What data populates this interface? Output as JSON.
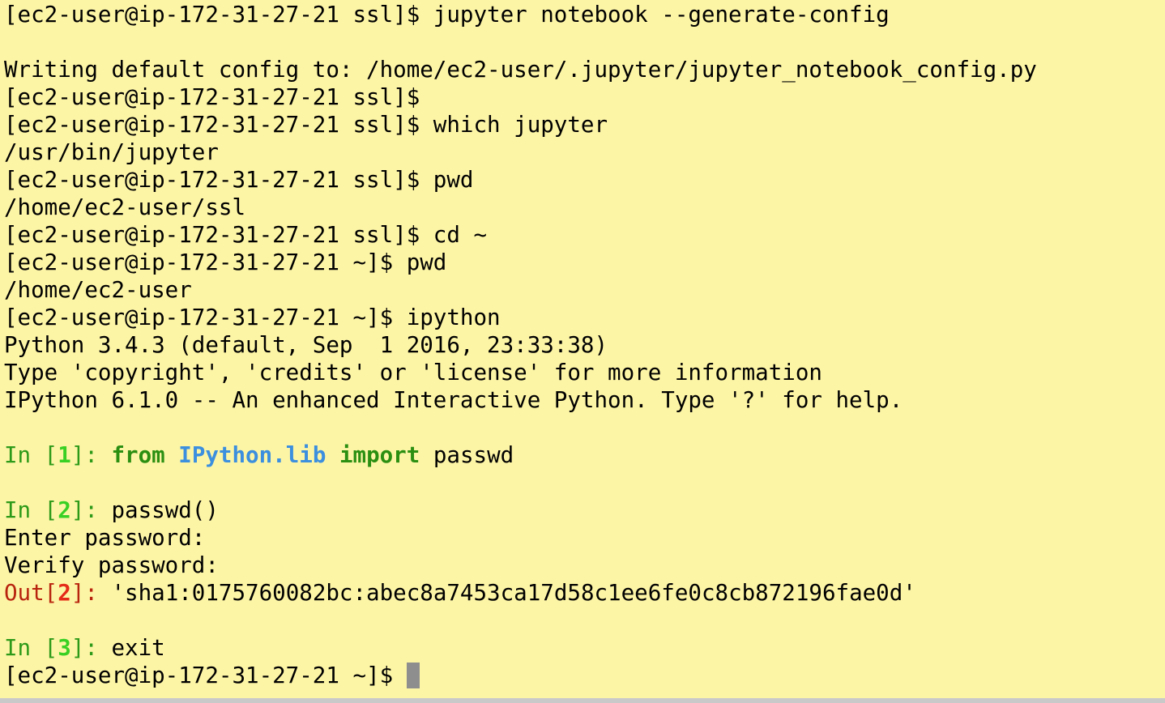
{
  "terminal": {
    "colors": {
      "background": "#fdf5a6",
      "text": "#000000",
      "prompt_green": "#2e9a19",
      "number_green": "#39d024",
      "keyword_green": "#2b8f12",
      "module_blue": "#3b8fde",
      "out_red": "#b8250f",
      "out_number_red": "#e42a18",
      "cursor": "#8e8e8e"
    },
    "lines": [
      {
        "segments": [
          {
            "text": "[ec2-user@ip-172-31-27-21 ssl]$ jupyter notebook --generate-config"
          }
        ]
      },
      {
        "segments": [
          {
            "text": ""
          }
        ]
      },
      {
        "segments": [
          {
            "text": "Writing default config to: /home/ec2-user/.jupyter/jupyter_notebook_config.py"
          }
        ]
      },
      {
        "segments": [
          {
            "text": "[ec2-user@ip-172-31-27-21 ssl]$"
          }
        ]
      },
      {
        "segments": [
          {
            "text": "[ec2-user@ip-172-31-27-21 ssl]$ which jupyter"
          }
        ]
      },
      {
        "segments": [
          {
            "text": "/usr/bin/jupyter"
          }
        ]
      },
      {
        "segments": [
          {
            "text": "[ec2-user@ip-172-31-27-21 ssl]$ pwd"
          }
        ]
      },
      {
        "segments": [
          {
            "text": "/home/ec2-user/ssl"
          }
        ]
      },
      {
        "segments": [
          {
            "text": "[ec2-user@ip-172-31-27-21 ssl]$ cd ~"
          }
        ]
      },
      {
        "segments": [
          {
            "text": "[ec2-user@ip-172-31-27-21 ~]$ pwd"
          }
        ]
      },
      {
        "segments": [
          {
            "text": "/home/ec2-user"
          }
        ]
      },
      {
        "segments": [
          {
            "text": "[ec2-user@ip-172-31-27-21 ~]$ ipython"
          }
        ]
      },
      {
        "segments": [
          {
            "text": "Python 3.4.3 (default, Sep  1 2016, 23:33:38)"
          }
        ]
      },
      {
        "segments": [
          {
            "text": "Type 'copyright', 'credits' or 'license' for more information"
          }
        ]
      },
      {
        "segments": [
          {
            "text": "IPython 6.1.0 -- An enhanced Interactive Python. Type '?' for help."
          }
        ]
      },
      {
        "segments": [
          {
            "text": ""
          }
        ]
      },
      {
        "segments": [
          {
            "text": "In [",
            "color": "#2e9a19"
          },
          {
            "text": "1",
            "color": "#39d024",
            "bold": true
          },
          {
            "text": "]: ",
            "color": "#2e9a19"
          },
          {
            "text": "from",
            "color": "#2b8f12",
            "bold": true
          },
          {
            "text": " "
          },
          {
            "text": "IPython.lib",
            "color": "#3b8fde",
            "bold": true
          },
          {
            "text": " "
          },
          {
            "text": "import",
            "color": "#2b8f12",
            "bold": true
          },
          {
            "text": " passwd"
          }
        ]
      },
      {
        "segments": [
          {
            "text": ""
          }
        ]
      },
      {
        "segments": [
          {
            "text": "In [",
            "color": "#2e9a19"
          },
          {
            "text": "2",
            "color": "#39d024",
            "bold": true
          },
          {
            "text": "]: ",
            "color": "#2e9a19"
          },
          {
            "text": "passwd()"
          }
        ]
      },
      {
        "segments": [
          {
            "text": "Enter password:"
          }
        ]
      },
      {
        "segments": [
          {
            "text": "Verify password:"
          }
        ]
      },
      {
        "segments": [
          {
            "text": "Out[",
            "color": "#b8250f"
          },
          {
            "text": "2",
            "color": "#e42a18",
            "bold": true
          },
          {
            "text": "]: ",
            "color": "#b8250f"
          },
          {
            "text": "'sha1:0175760082bc:abec8a7453ca17d58c1ee6fe0c8cb872196fae0d'"
          }
        ]
      },
      {
        "segments": [
          {
            "text": ""
          }
        ]
      },
      {
        "segments": [
          {
            "text": "In [",
            "color": "#2e9a19"
          },
          {
            "text": "3",
            "color": "#39d024",
            "bold": true
          },
          {
            "text": "]: ",
            "color": "#2e9a19"
          },
          {
            "text": "exit"
          }
        ]
      },
      {
        "segments": [
          {
            "text": "[ec2-user@ip-172-31-27-21 ~]$ "
          }
        ],
        "cursor": true
      }
    ]
  }
}
